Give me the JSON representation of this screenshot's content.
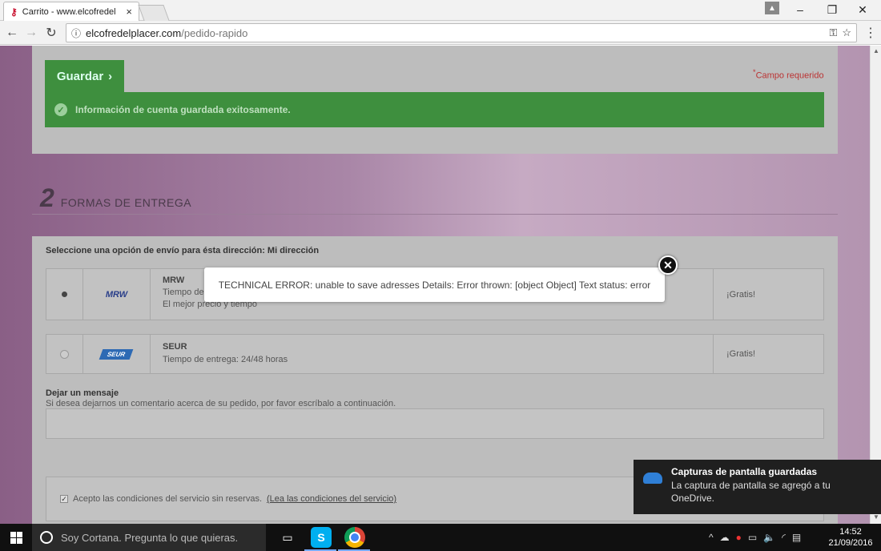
{
  "browser": {
    "tab_title": "Carrito - www.elcofredel",
    "url_host": "elcofredelplacer.com",
    "url_path": "/pedido-rapido"
  },
  "account": {
    "save_button": "Guardar",
    "required_note": "Campo requerido",
    "success_message": "Información de cuenta guardada exitosamente."
  },
  "delivery": {
    "section_number": "2",
    "section_title": "FORMAS DE ENTREGA",
    "select_heading": "Seleccione una opción de envío para ésta dirección: Mi dirección",
    "options": [
      {
        "name": "MRW",
        "line1": "Tiempo de",
        "line2": "El mejor precio y tiempo",
        "price": "¡Gratis!",
        "logo": "MRW",
        "selected": true
      },
      {
        "name": "SEUR",
        "line1": "Tiempo de entrega: 24/48 horas",
        "line2": "",
        "price": "¡Gratis!",
        "logo": "SEUR",
        "selected": false
      }
    ],
    "message_label": "Dejar un mensaje",
    "message_sub": "Si desea dejarnos un comentario acerca de su pedido, por favor escríbalo a continuación.",
    "terms_text": "Acepto las condiciones del servicio sin reservas.",
    "terms_link": "(Lea las condiciones del servicio)"
  },
  "modal": {
    "message": "TECHNICAL ERROR: unable to save adresses Details: Error thrown: [object Object] Text status: error"
  },
  "toast": {
    "title": "Capturas de pantalla guardadas",
    "body": "La captura de pantalla se agregó a tu OneDrive."
  },
  "taskbar": {
    "cortana_placeholder": "Soy Cortana. Pregunta lo que quieras.",
    "time": "14:52",
    "date": "21/09/2016"
  },
  "colors": {
    "success_green": "#3e8f3e",
    "toast_bg": "#1f1f1f",
    "taskbar_bg": "#101010"
  }
}
